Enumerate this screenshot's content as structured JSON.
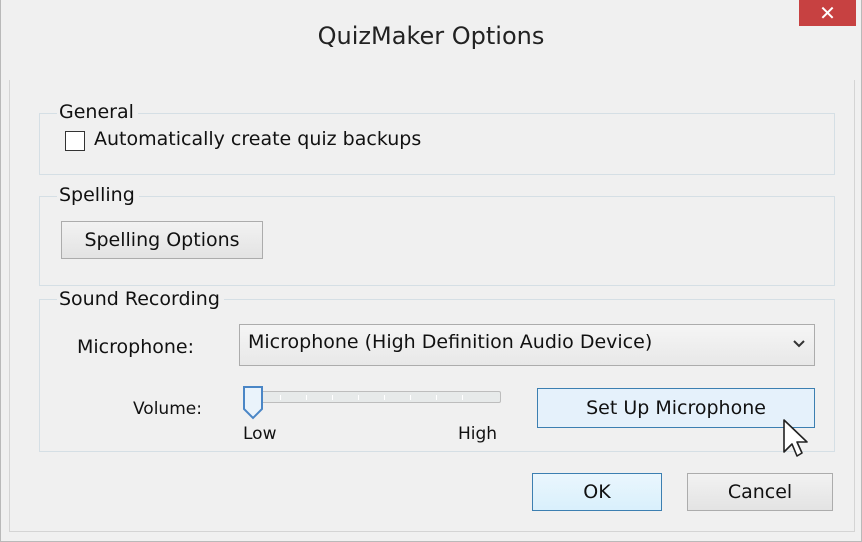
{
  "window": {
    "title": "QuizMaker Options",
    "close_glyph": "✕"
  },
  "general": {
    "legend": "General",
    "auto_backup": {
      "label": "Automatically create quiz backups",
      "checked": false
    }
  },
  "spelling": {
    "legend": "Spelling",
    "options_button": "Spelling Options"
  },
  "sound": {
    "legend": "Sound Recording",
    "microphone_label": "Microphone:",
    "microphone_value": "Microphone (High Definition Audio Device)",
    "volume_label": "Volume:",
    "volume_level": 0,
    "volume_low": "Low",
    "volume_high": "High",
    "setup_button": "Set Up Microphone"
  },
  "footer": {
    "ok": "OK",
    "cancel": "Cancel"
  },
  "icons": {
    "close": "close-icon",
    "dropdown": "chevron-down-icon",
    "cursor": "mouse-pointer-icon"
  },
  "colors": {
    "close_bg": "#c74141",
    "focus_border": "#3c7fb1",
    "window_bg": "#f0f0f0"
  }
}
